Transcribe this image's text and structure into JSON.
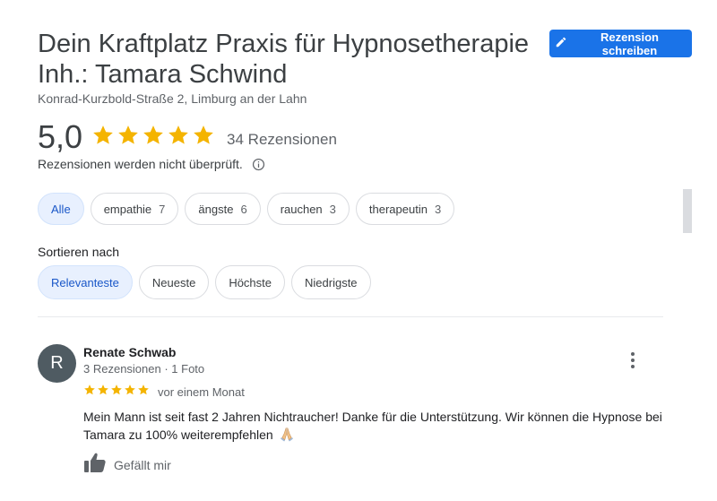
{
  "place": {
    "title": "Dein Kraftplatz Praxis für Hypnosetherapie Inh.: Tamara Schwind",
    "address": "Konrad-Kurzbold-Straße 2, Limburg an der Lahn"
  },
  "actions": {
    "write_review_label": "Rezension schreiben",
    "write_review_icon": "pencil-icon"
  },
  "rating": {
    "value": "5,0",
    "stars": 5,
    "review_count": "34 Rezensionen",
    "unverified_note": "Rezensionen werden nicht überprüft.",
    "star_color": "#f4b400"
  },
  "topics": [
    {
      "label": "Alle",
      "count": ""
    },
    {
      "label": "empathie",
      "count": "7"
    },
    {
      "label": "ängste",
      "count": "6"
    },
    {
      "label": "rauchen",
      "count": "3"
    },
    {
      "label": "therapeutin",
      "count": "3"
    }
  ],
  "sort": {
    "label": "Sortieren nach",
    "options": [
      "Relevanteste",
      "Neueste",
      "Höchste",
      "Niedrigste"
    ],
    "selected": "Relevanteste"
  },
  "review": {
    "avatar_initial": "R",
    "author": "Renate Schwab",
    "meta": "3 Rezensionen · 1 Foto",
    "stars": 5,
    "date": "vor einem Monat",
    "text": "Mein Mann ist seit fast 2 Jahren Nichtraucher! Danke für die Unterstützung. Wir können die Hypnose bei Tamara zu 100% weiterempfehlen",
    "like_label": "Gefällt mir"
  },
  "colors": {
    "accent": "#1a73e8",
    "active_chip_bg": "#e8f0fe",
    "active_chip_text": "#1a57c8",
    "avatar_bg": "#4f5b62"
  }
}
